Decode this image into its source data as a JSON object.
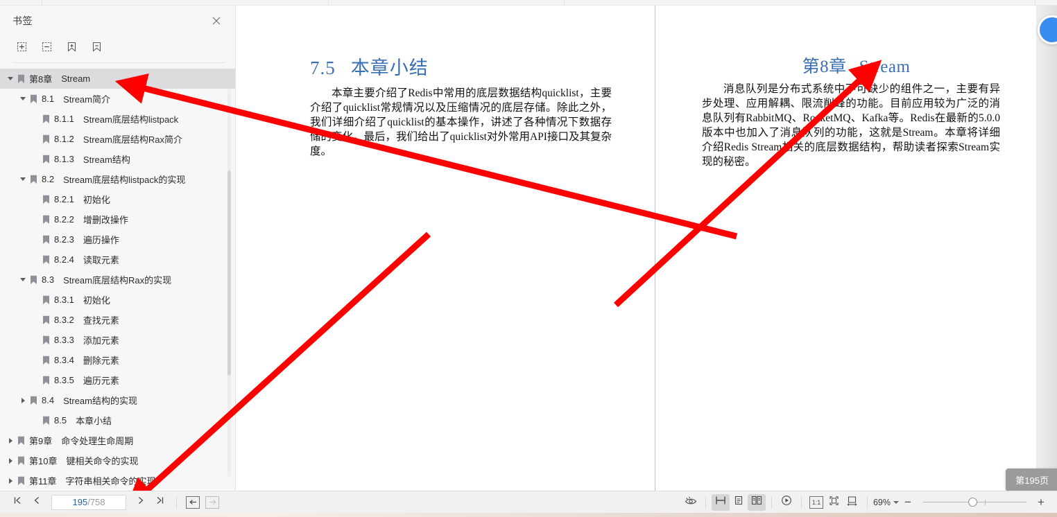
{
  "sidebar": {
    "title": "书签",
    "close_icon": "close-icon",
    "tools": [
      {
        "name": "expand-all-button",
        "icon": "expand-all-icon"
      },
      {
        "name": "collapse-all-button",
        "icon": "collapse-all-icon"
      },
      {
        "name": "add-bookmark-button",
        "icon": "bookmark-plus-icon"
      },
      {
        "name": "remove-bookmark-button",
        "icon": "bookmark-minus-icon"
      }
    ],
    "tree": [
      {
        "num": "第8章",
        "label": "Stream",
        "level": 0,
        "twisty": "open",
        "selected": true
      },
      {
        "num": "8.1",
        "label": "Stream简介",
        "level": 1,
        "twisty": "open",
        "selected": false
      },
      {
        "num": "8.1.1",
        "label": "Stream底层结构listpack",
        "level": 2,
        "twisty": "none",
        "selected": false
      },
      {
        "num": "8.1.2",
        "label": "Stream底层结构Rax简介",
        "level": 2,
        "twisty": "none",
        "selected": false
      },
      {
        "num": "8.1.3",
        "label": "Stream结构",
        "level": 2,
        "twisty": "none",
        "selected": false
      },
      {
        "num": "8.2",
        "label": "Stream底层结构listpack的实现",
        "level": 1,
        "twisty": "open",
        "selected": false
      },
      {
        "num": "8.2.1",
        "label": "初始化",
        "level": 2,
        "twisty": "none",
        "selected": false
      },
      {
        "num": "8.2.2",
        "label": "增删改操作",
        "level": 2,
        "twisty": "none",
        "selected": false
      },
      {
        "num": "8.2.3",
        "label": "遍历操作",
        "level": 2,
        "twisty": "none",
        "selected": false
      },
      {
        "num": "8.2.4",
        "label": "读取元素",
        "level": 2,
        "twisty": "none",
        "selected": false
      },
      {
        "num": "8.3",
        "label": "Stream底层结构Rax的实现",
        "level": 1,
        "twisty": "open",
        "selected": false
      },
      {
        "num": "8.3.1",
        "label": "初始化",
        "level": 2,
        "twisty": "none",
        "selected": false
      },
      {
        "num": "8.3.2",
        "label": "查找元素",
        "level": 2,
        "twisty": "none",
        "selected": false
      },
      {
        "num": "8.3.3",
        "label": "添加元素",
        "level": 2,
        "twisty": "none",
        "selected": false
      },
      {
        "num": "8.3.4",
        "label": "删除元素",
        "level": 2,
        "twisty": "none",
        "selected": false
      },
      {
        "num": "8.3.5",
        "label": "遍历元素",
        "level": 2,
        "twisty": "none",
        "selected": false
      },
      {
        "num": "8.4",
        "label": "Stream结构的实现",
        "level": 1,
        "twisty": "closed",
        "selected": false
      },
      {
        "num": "8.5",
        "label": "本章小结",
        "level": 2,
        "twisty": "none",
        "selected": false
      },
      {
        "num": "第9章",
        "label": "命令处理生命周期",
        "level": 0,
        "twisty": "closed",
        "selected": false
      },
      {
        "num": "第10章",
        "label": "键相关命令的实现",
        "level": 0,
        "twisty": "closed",
        "selected": false
      },
      {
        "num": "第11章",
        "label": "字符串相关命令的实现",
        "level": 0,
        "twisty": "closed",
        "selected": false
      }
    ]
  },
  "document": {
    "left_page": {
      "heading_num": "7.5",
      "heading_text": "本章小结",
      "body": "本章主要介绍了Redis中常用的底层数据结构quicklist，主要介绍了quicklist常规情况以及压缩情况的底层存储。除此之外，我们详细介绍了quicklist的基本操作，讲述了各种情况下数据存储的变化。最后，我们给出了quicklist对外常用API接口及其复杂度。"
    },
    "right_page": {
      "heading_num": "第8章",
      "heading_text": "Stream",
      "body": "消息队列是分布式系统中不可缺少的组件之一，主要有异步处理、应用解耦、限流削峰的功能。目前应用较为广泛的消息队列有RabbitMQ、RocketMQ、Kafka等。Redis在最新的5.0.0版本中也加入了消息队列的功能，这就是Stream。本章将详细介绍Redis Stream相关的底层数据结构，帮助读者探索Stream实现的秘密。"
    },
    "page_badge": "第195页"
  },
  "toolbar": {
    "first_page_icon": "first-page-icon",
    "prev_page_icon": "prev-page-icon",
    "current_page": "195",
    "page_separator": "/",
    "total_pages": "758",
    "page_placeholder": "195/758",
    "next_page_icon": "next-page-icon",
    "last_page_icon": "last-page-icon",
    "nav_back_icon": "nav-back-icon",
    "nav_forward_icon": "nav-forward-icon",
    "eye_protect_icon": "eye-protection-icon",
    "continuous_scroll_icon": "continuous-scroll-icon",
    "single_page_icon": "single-page-icon",
    "double_page_icon": "double-page-icon",
    "presentation_icon": "presentation-play-icon",
    "actual_size_label": "1:1",
    "fit_page_icon": "fit-page-icon",
    "fit_width_icon": "fit-width-icon",
    "zoom_level": "69%",
    "zoom_out_label": "−",
    "zoom_in_label": "+"
  },
  "colors": {
    "heading_blue": "#3b6fb5",
    "annotation_red": "#ff0000",
    "selected_row": "#dcdcdf",
    "page_badge_bg": "#9b9b9b",
    "blue_badge": "#3a8bf0"
  }
}
